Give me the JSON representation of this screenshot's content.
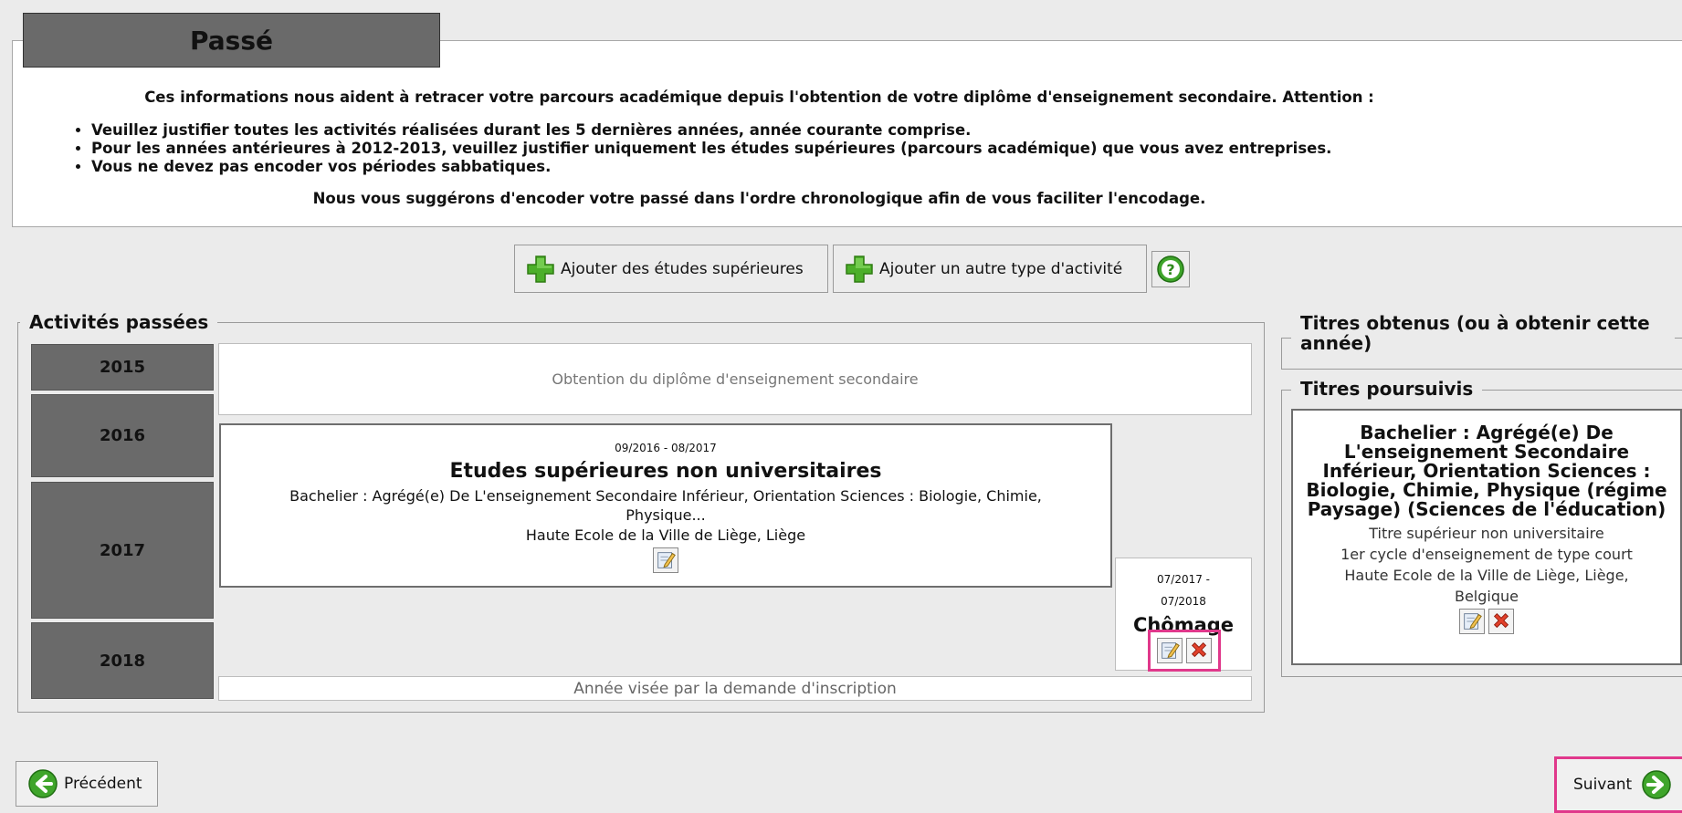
{
  "section": {
    "title": "Passé"
  },
  "info": {
    "intro": "Ces informations nous aident à retracer votre parcours académique depuis l'obtention de votre diplôme d'enseignement secondaire. Attention :",
    "rules": [
      "Veuillez justifier toutes les activités réalisées durant les 5 dernières années, année courante comprise.",
      "Pour les années antérieures à 2012-2013, veuillez justifier uniquement les études supérieures (parcours académique) que vous avez entreprises.",
      "Vous ne devez pas encoder vos périodes sabbatiques."
    ],
    "suggestion": "Nous vous suggérons d'encoder votre passé dans l'ordre chronologique afin de vous faciliter l'encodage."
  },
  "actions": {
    "add_higher_label": "Ajouter des études supérieures",
    "add_other_label": "Ajouter un autre type d'activité",
    "help_icon": "help-icon"
  },
  "activities": {
    "legend": "Activités passées",
    "years": [
      "2015",
      "2016",
      "2017",
      "2018"
    ],
    "secondary_diploma": "Obtention du diplôme d'enseignement secondaire",
    "studies": {
      "dates": "09/2016 - 08/2017",
      "type": "Etudes supérieures non universitaires",
      "description": "Bachelier : Agrégé(e) De L'enseignement Secondaire Inférieur, Orientation Sciences : Biologie, Chimie, Physique...",
      "school": "Haute Ecole de la Ville de Liège, Liège"
    },
    "chomage": {
      "dates_start": "07/2017 -",
      "dates_end": "07/2018",
      "type": "Chômage"
    },
    "target_year": "Année visée par la demande d'inscription"
  },
  "titles_obtained": {
    "legend": "Titres obtenus (ou à obtenir cette année)"
  },
  "titles_pursued": {
    "legend": "Titres poursuivis",
    "name": "Bachelier : Agrégé(e) De L'enseignement Secondaire Inférieur, Orientation Sciences : Biologie, Chimie, Physique (régime Paysage) (Sciences de l'éducation)",
    "level": "Titre supérieur non universitaire",
    "cycle": "1er cycle d'enseignement de type court",
    "school": "Haute Ecole de la Ville de Liège, Liège,",
    "country": "Belgique"
  },
  "nav": {
    "prev_label": "Précédent",
    "next_label": "Suivant"
  },
  "colors": {
    "year_box": "#6a6a6a",
    "highlight": "#e0388b",
    "plus_green": "#4caf2a"
  }
}
